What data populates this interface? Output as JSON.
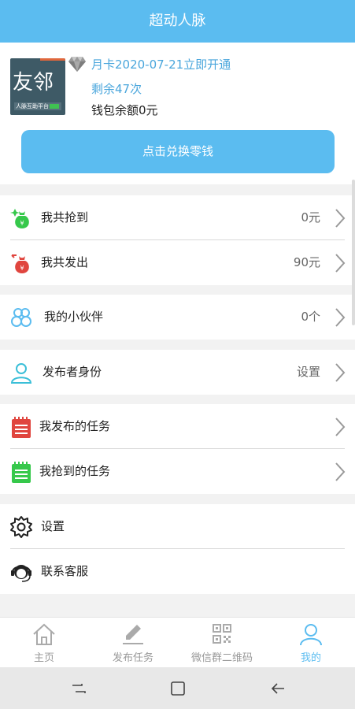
{
  "header": {
    "title": "超动人脉"
  },
  "profile": {
    "logo_text": "友邻",
    "logo_tag": "人脉互助平台",
    "vip_status": "月卡2020-07-21立即开通",
    "remaining": "剩余47次",
    "wallet": "钱包余额0元",
    "exchange_label": "点击兑换零钱"
  },
  "menu": {
    "grabbed": {
      "label": "我共抢到",
      "value": "0元"
    },
    "sent": {
      "label": "我共发出",
      "value": "90元"
    },
    "partners": {
      "label": "我的小伙伴",
      "value": "0个"
    },
    "publisher": {
      "label": "发布者身份",
      "value": "设置"
    },
    "my_tasks": {
      "label": "我发布的任务"
    },
    "grabbed_tasks": {
      "label": "我抢到的任务"
    },
    "settings": {
      "label": "设置"
    },
    "support": {
      "label": "联系客服"
    }
  },
  "tabbar": {
    "home": "主页",
    "publish": "发布任务",
    "qrcode": "微信群二维码",
    "mine": "我的"
  },
  "colors": {
    "accent": "#5bbcf0",
    "red": "#e0453e",
    "green": "#36c84b"
  }
}
